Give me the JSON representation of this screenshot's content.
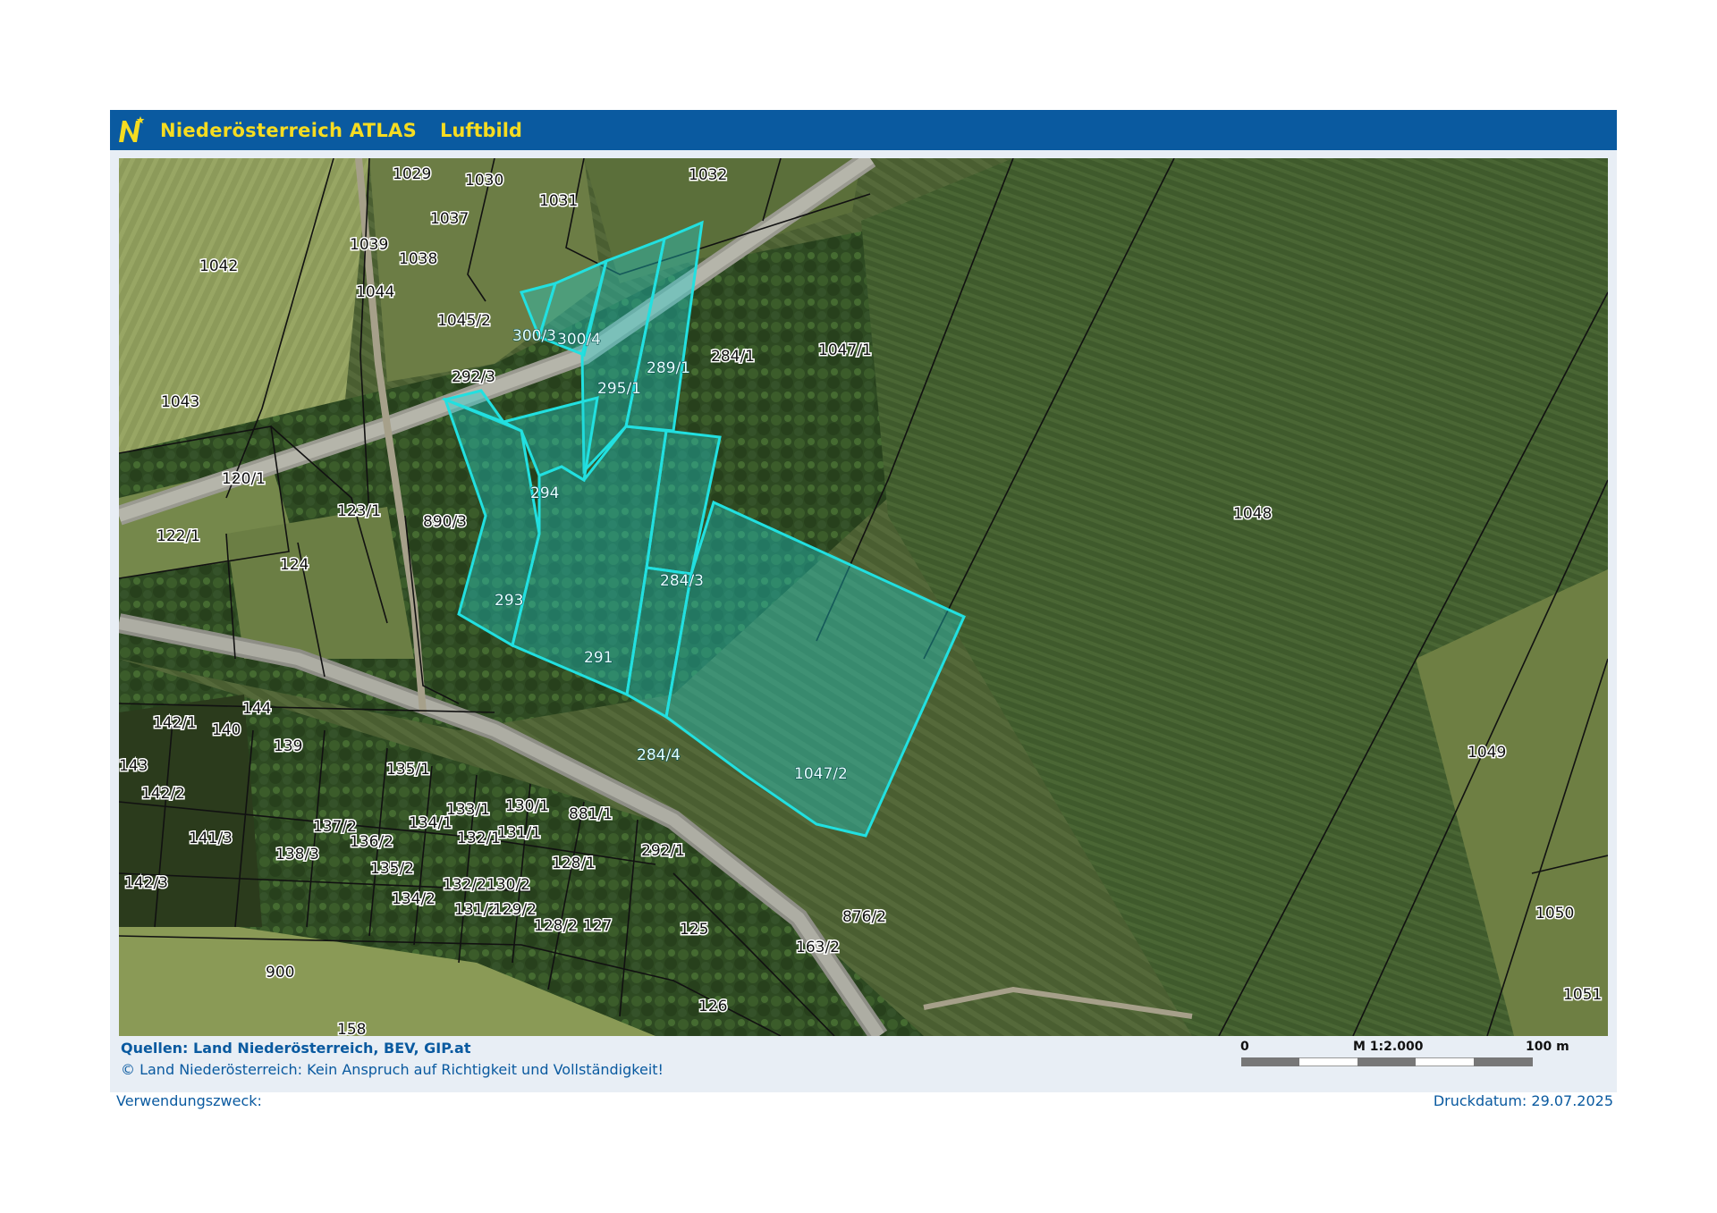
{
  "header": {
    "app_title": "Niederösterreich ATLAS",
    "layer_title": "Luftbild",
    "logo_glyph": "N",
    "brand_color": "#0a5aa0",
    "title_color": "#f6dc21"
  },
  "map": {
    "view": "aerial photo with cadastral parcel boundaries",
    "highlight_color": "#1fdcdc",
    "parcels": [
      {
        "label": "1029"
      },
      {
        "label": "1030"
      },
      {
        "label": "1032"
      },
      {
        "label": "1031"
      },
      {
        "label": "1037"
      },
      {
        "label": "1039"
      },
      {
        "label": "1038"
      },
      {
        "label": "1042"
      },
      {
        "label": "1044"
      },
      {
        "label": "1045/2"
      },
      {
        "label": "1043"
      },
      {
        "label": "292/3"
      },
      {
        "label": "284/1"
      },
      {
        "label": "1047/1"
      },
      {
        "label": "120/1"
      },
      {
        "label": "123/1"
      },
      {
        "label": "890/3"
      },
      {
        "label": "122/1"
      },
      {
        "label": "124"
      },
      {
        "label": "1048"
      },
      {
        "label": "144"
      },
      {
        "label": "142/1"
      },
      {
        "label": "140"
      },
      {
        "label": "139"
      },
      {
        "label": "143"
      },
      {
        "label": "135/1"
      },
      {
        "label": "142/2"
      },
      {
        "label": "133/1"
      },
      {
        "label": "130/1"
      },
      {
        "label": "881/1"
      },
      {
        "label": "137/2"
      },
      {
        "label": "134/1"
      },
      {
        "label": "136/2"
      },
      {
        "label": "132/1"
      },
      {
        "label": "131/1"
      },
      {
        "label": "141/3"
      },
      {
        "label": "138/3"
      },
      {
        "label": "292/1"
      },
      {
        "label": "135/2"
      },
      {
        "label": "128/1"
      },
      {
        "label": "142/3"
      },
      {
        "label": "132/2"
      },
      {
        "label": "130/2"
      },
      {
        "label": "134/2"
      },
      {
        "label": "131/2"
      },
      {
        "label": "129/2"
      },
      {
        "label": "128/2"
      },
      {
        "label": "127"
      },
      {
        "label": "125"
      },
      {
        "label": "876/2"
      },
      {
        "label": "163/2"
      },
      {
        "label": "900"
      },
      {
        "label": "126"
      },
      {
        "label": "158"
      },
      {
        "label": "1049"
      },
      {
        "label": "1050"
      },
      {
        "label": "1051"
      }
    ],
    "highlighted_parcels": [
      {
        "label": "300/3"
      },
      {
        "label": "300/4"
      },
      {
        "label": "295/1"
      },
      {
        "label": "289/1"
      },
      {
        "label": "294"
      },
      {
        "label": "293"
      },
      {
        "label": "284/3"
      },
      {
        "label": "291"
      },
      {
        "label": "284/4"
      },
      {
        "label": "1047/2"
      }
    ]
  },
  "footer": {
    "sources": "Quellen: Land Niederösterreich, BEV, GIP.at",
    "copyright": "© Land Niederösterreich: Kein Anspruch auf Richtigkeit und Vollständigkeit!",
    "scale_zero": "0",
    "scale_ratio": "M 1:2.000",
    "scale_end": "100 m",
    "purpose_label": "Verwendungszweck:",
    "print_date": "Druckdatum: 29.07.2025"
  }
}
